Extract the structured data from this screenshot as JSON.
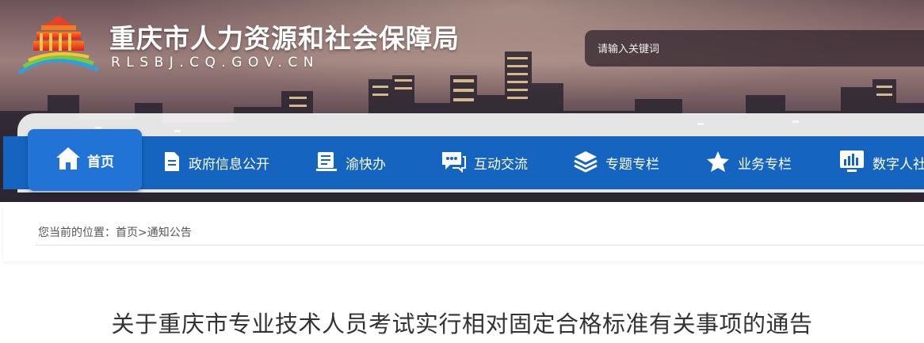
{
  "header": {
    "site_title": "重庆市人力资源和社会保障局",
    "site_domain": "RLSBJ.CQ.GOV.CN",
    "search": {
      "placeholder": "请输入关键词"
    }
  },
  "nav": {
    "items": [
      {
        "label": "首页",
        "icon": "home-icon",
        "active": true
      },
      {
        "label": "政府信息公开",
        "icon": "document-icon"
      },
      {
        "label": "渝快办",
        "icon": "book-icon"
      },
      {
        "label": "互动交流",
        "icon": "chat-icon"
      },
      {
        "label": "专题专栏",
        "icon": "layers-icon"
      },
      {
        "label": "业务专栏",
        "icon": "star-icon"
      },
      {
        "label": "数字人社",
        "icon": "chart-monitor-icon"
      }
    ]
  },
  "breadcrumb": {
    "prefix": "您当前的位置：",
    "home": "首页",
    "separator": ">",
    "current": "通知公告"
  },
  "article": {
    "title": "关于重庆市专业技术人员考试实行相对固定合格标准有关事项的通告"
  },
  "colors": {
    "nav_bg": "#1565c0",
    "nav_active": "#2173d6",
    "title_text": "#333333"
  }
}
